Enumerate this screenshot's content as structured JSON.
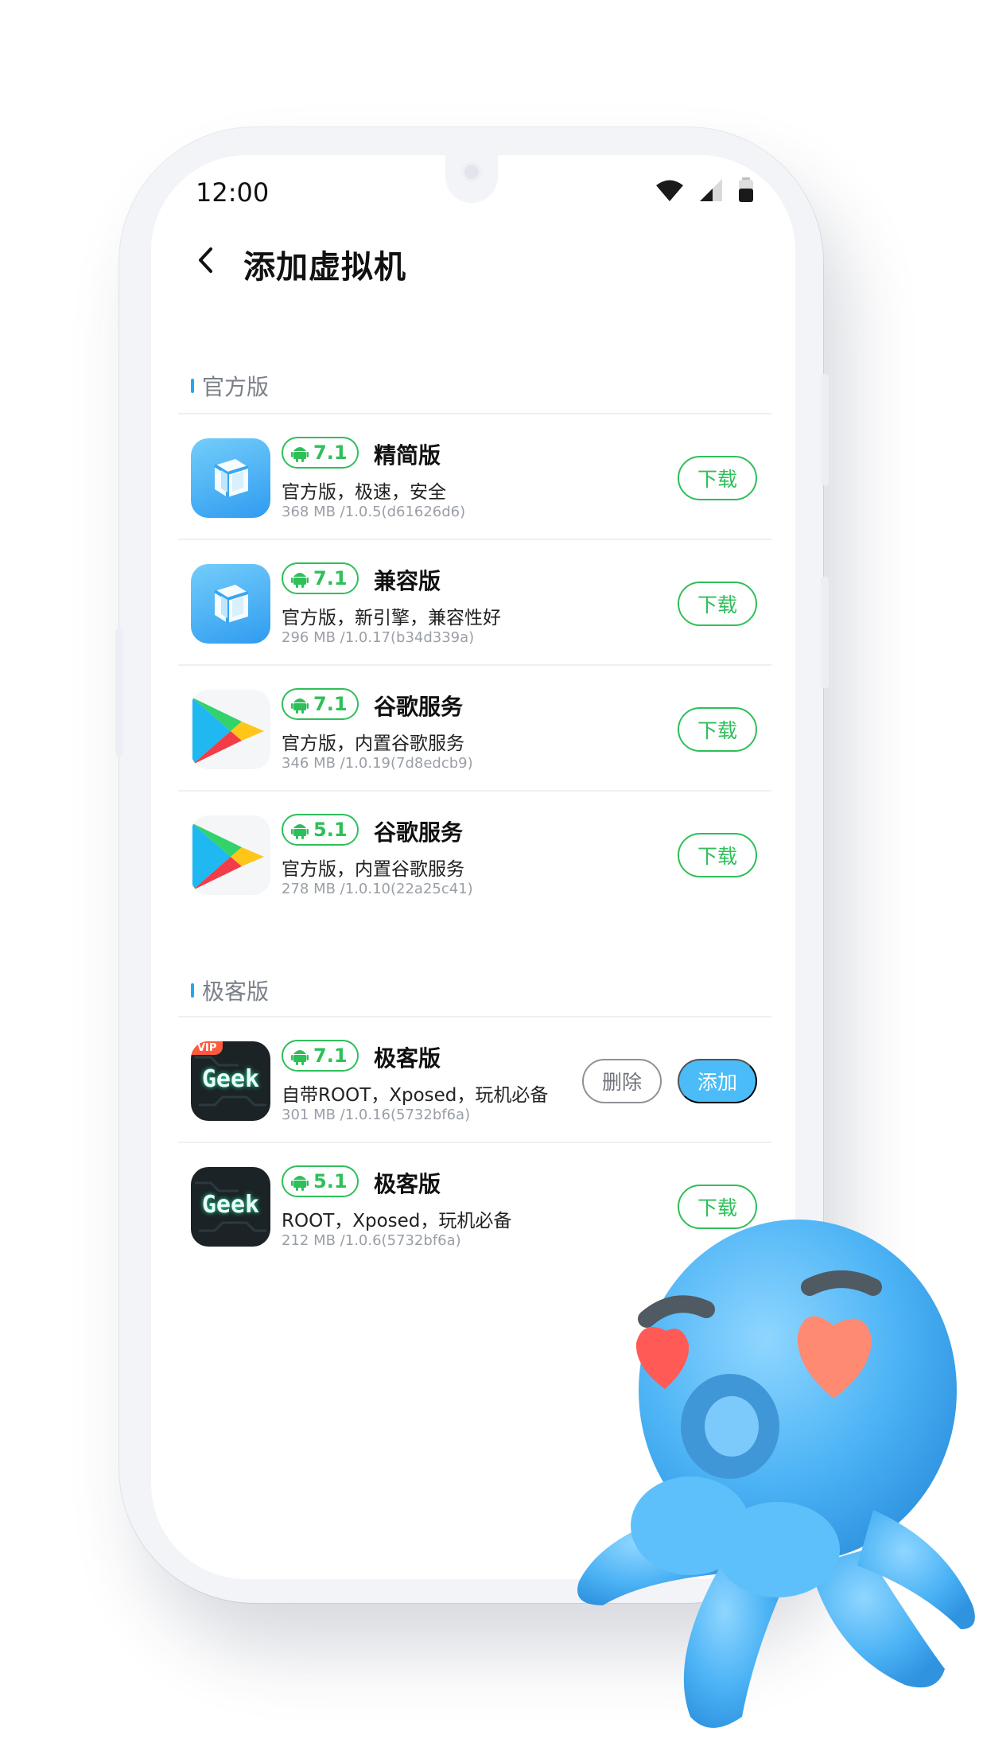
{
  "status_bar": {
    "time": "12:00"
  },
  "header": {
    "title": "添加虚拟机"
  },
  "sections": [
    {
      "title": "官方版",
      "items": [
        {
          "version": "7.1",
          "name": "精简版",
          "desc": "官方版，极速，安全",
          "meta": "368 MB /1.0.5(d61626d6)",
          "action": "下载",
          "icon": "vmos-cube-icon"
        },
        {
          "version": "7.1",
          "name": "兼容版",
          "desc": "官方版，新引擎，兼容性好",
          "meta": "296 MB /1.0.17(b34d339a)",
          "action": "下载",
          "icon": "vmos-cube-icon"
        },
        {
          "version": "7.1",
          "name": "谷歌服务",
          "desc": "官方版，内置谷歌服务",
          "meta": "346 MB /1.0.19(7d8edcb9)",
          "action": "下载",
          "icon": "google-play-icon"
        },
        {
          "version": "5.1",
          "name": "谷歌服务",
          "desc": "官方版，内置谷歌服务",
          "meta": "278 MB /1.0.10(22a25c41)",
          "action": "下载",
          "icon": "google-play-icon"
        }
      ]
    },
    {
      "title": "极客版",
      "items": [
        {
          "version": "7.1",
          "name": "极客版",
          "desc": "自带ROOT，Xposed，玩机必备",
          "meta": "301 MB /1.0.16(5732bf6a)",
          "delete_label": "删除",
          "add_label": "添加",
          "icon": "geek-icon",
          "vip_tag": "VIP",
          "icon_text": "Geek"
        },
        {
          "version": "5.1",
          "name": "极客版",
          "desc": "ROOT，Xposed，玩机必备",
          "meta": "212 MB /1.0.6(5732bf6a)",
          "action": "下载",
          "icon": "geek-icon",
          "icon_text": "Geek"
        }
      ]
    }
  ],
  "colors": {
    "accent_green": "#2fbf5a",
    "accent_blue": "#4bbcf7",
    "section_mark": "#22a8f0"
  }
}
